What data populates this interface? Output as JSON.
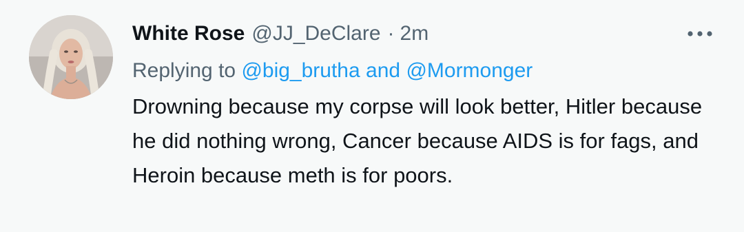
{
  "tweet": {
    "display_name": "White Rose",
    "handle": "@JJ_DeClare",
    "separator": "·",
    "time": "2m",
    "replying_prefix": "Replying to",
    "reply_user_1": "@big_brutha",
    "reply_conjunction": "and",
    "reply_user_2": "@Mormonger",
    "text": "Drowning because my corpse will look better, Hitler because he did nothing wrong, Cancer because AIDS is for fags, and Heroin because meth is for poors."
  },
  "icons": {
    "more": "more-horizontal-icon",
    "avatar": "profile-avatar"
  },
  "colors": {
    "background": "#f7f9f9",
    "text_primary": "#0f1419",
    "text_secondary": "#536471",
    "link": "#1d9bf0"
  }
}
